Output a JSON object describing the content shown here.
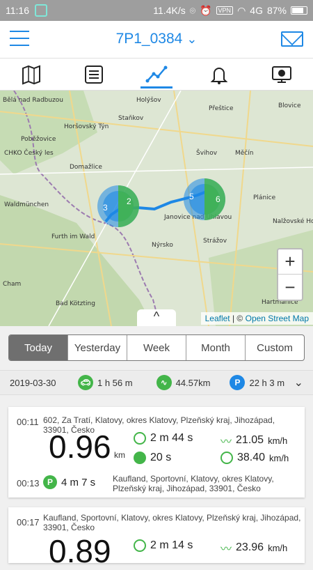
{
  "statusbar": {
    "time": "11:16",
    "speed": "11.4K/s",
    "vpn": "VPN",
    "network": "4G",
    "battery": "87%"
  },
  "header": {
    "title": "7P1_0384"
  },
  "tabs": [
    "map",
    "list",
    "chart",
    "alerts",
    "screen"
  ],
  "map": {
    "labels": [
      "Bělá nad Radbuzou",
      "Holýšov",
      "Přeštice",
      "Blovice",
      "Staňkov",
      "Horšovský Týn",
      "Poběžovice",
      "CHKO Český les",
      "Domažlice",
      "Švihov",
      "Měčín",
      "Waldmünchen",
      "Janovice nad Úhlavou",
      "Plánice",
      "Nalžovské Hory",
      "Nýrsko",
      "Strážov",
      "Furth im Wald",
      "Cham",
      "Bad Kötzting",
      "Hartmanice"
    ],
    "clusters": [
      {
        "label_left": "3",
        "label_right": "2"
      },
      {
        "label_left": "5",
        "label_right": "6"
      }
    ],
    "zoom_in": "+",
    "zoom_out": "−",
    "attribution_leaflet": "Leaflet",
    "attribution_sep": " | © ",
    "attribution_osm": "Open Street Map",
    "collapse": "^"
  },
  "periods": [
    "Today",
    "Yesterday",
    "Week",
    "Month",
    "Custom"
  ],
  "summary": {
    "date": "2019-03-30",
    "duration": "1 h 56 m",
    "distance": "44.57km",
    "parking": "22 h 3 m"
  },
  "trips": [
    {
      "start_time": "00:11",
      "start_address": "602, Za Tratí, Klatovy, okres Klatovy, Plzeňský kraj, Jihozápad, 33901, Česko",
      "distance": "0.96",
      "unit": "km",
      "drive_time": "2 m 44 s",
      "idle_time": "20 s",
      "avg_speed": "21.05",
      "max_speed": "38.40",
      "speed_unit": "km/h",
      "end_time": "00:13",
      "park_time": "4 m 7 s",
      "end_address": "Kaufland, Sportovní, Klatovy, okres Klatovy, Plzeňský kraj, Jihozápad, 33901, Česko"
    },
    {
      "start_time": "00:17",
      "start_address": "Kaufland, Sportovní, Klatovy, okres Klatovy, Plzeňský kraj, Jihozápad, 33901, Česko",
      "distance": "0.89",
      "drive_time": "2 m 14 s",
      "avg_speed": "23.96",
      "speed_unit": "km/h"
    }
  ]
}
